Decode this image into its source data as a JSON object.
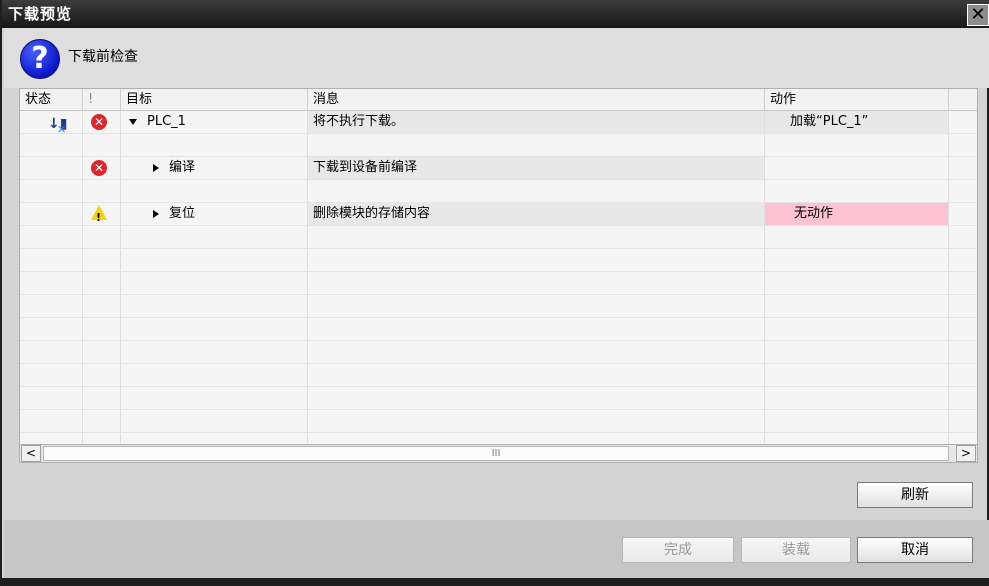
{
  "window": {
    "title": "下载预览",
    "close_glyph": "✕"
  },
  "header": {
    "icon": "question-icon",
    "icon_glyph": "?",
    "text": "下载前检查"
  },
  "columns": {
    "status": "状态",
    "flag": "!",
    "target": "目标",
    "message": "消息",
    "action": "动作"
  },
  "rows": [
    {
      "target": "PLC_1",
      "message": "将不执行下载。",
      "action": "加载“PLC_1”",
      "severity": "error",
      "expanded": true
    },
    {
      "target": "编译",
      "message": "下载到设备前编译",
      "action": "",
      "severity": "error",
      "expanded": false
    },
    {
      "target": "复位",
      "message": "删除模块的存储内容",
      "action": "无动作",
      "severity": "warning",
      "expanded": false
    }
  ],
  "scrollbar": {
    "left": "<",
    "right": ">",
    "thumb": "III"
  },
  "buttons": {
    "refresh": "刷新",
    "finish": "完成",
    "load": "装载",
    "cancel": "取消"
  },
  "colors": {
    "action_pink": "#fdc3d2",
    "error_red": "#e0262b",
    "warning_yellow": "#f5d40c",
    "question_blue": "#0a16c8"
  }
}
